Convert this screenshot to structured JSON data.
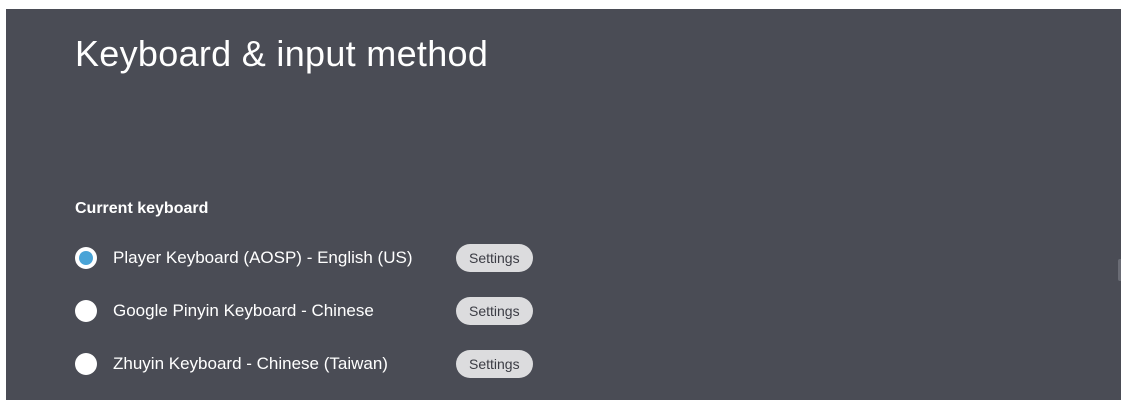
{
  "page": {
    "title": "Keyboard & input method",
    "section_header": "Current keyboard"
  },
  "keyboards": [
    {
      "label": "Player Keyboard (AOSP) - English (US)",
      "selected": true,
      "settings_label": "Settings"
    },
    {
      "label": "Google Pinyin Keyboard - Chinese",
      "selected": false,
      "settings_label": "Settings"
    },
    {
      "label": "Zhuyin Keyboard - Chinese (Taiwan)",
      "selected": false,
      "settings_label": "Settings"
    }
  ],
  "colors": {
    "panel_background": "#4a4c55",
    "radio_selected_accent": "#4aa4d7",
    "button_background": "#dcdcde"
  },
  "icons": {
    "radio_selected": "radio-selected-icon",
    "radio_unselected": "radio-unselected-icon"
  }
}
